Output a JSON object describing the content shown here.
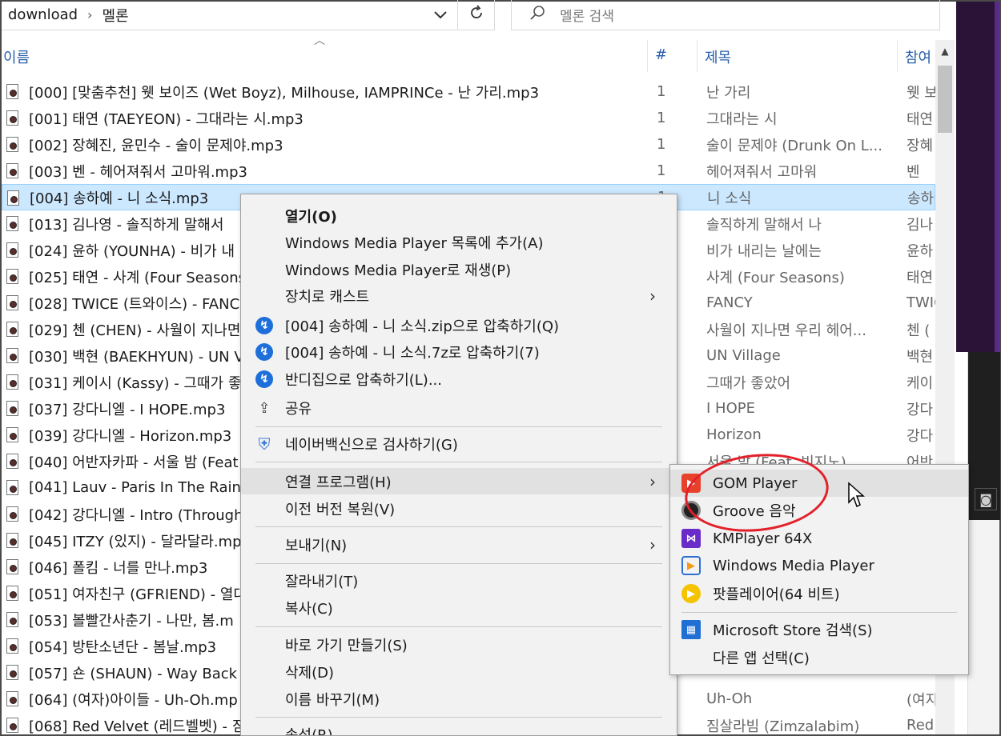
{
  "address": {
    "crumbs": [
      "download",
      "멜론"
    ]
  },
  "search": {
    "placeholder": "멜론 검색"
  },
  "columns": {
    "name": "이름",
    "num": "#",
    "title": "제목",
    "artist": "참여"
  },
  "rows": [
    {
      "name": "[000] [맞춤추천] 웻 보이즈 (Wet Boyz), Milhouse, IAMPRINCe - 난 가리.mp3",
      "num": "1",
      "title": "난 가리",
      "artist": "웻 보"
    },
    {
      "name": "[001] 태연 (TAEYEON) - 그대라는 시.mp3",
      "num": "1",
      "title": "그대라는 시",
      "artist": "태연"
    },
    {
      "name": "[002] 장혜진, 윤민수 - 술이 문제야.mp3",
      "num": "1",
      "title": "술이 문제야 (Drunk On L...",
      "artist": "장혜"
    },
    {
      "name": "[003] 벤 - 헤어져줘서 고마워.mp3",
      "num": "1",
      "title": "헤어져줘서 고마워",
      "artist": "벤"
    },
    {
      "name": "[004] 송하예 - 니 소식.mp3",
      "num": "1",
      "title": "니 소식",
      "artist": "송하"
    },
    {
      "name": "[013] 김나영 - 솔직하게 말해서",
      "num": "",
      "title": "솔직하게 말해서 나",
      "artist": "김나"
    },
    {
      "name": "[024] 윤하 (YOUNHA) - 비가 내",
      "num": "",
      "title": "비가 내리는 날에는",
      "artist": "윤하"
    },
    {
      "name": "[025] 태연 - 사계 (Four Seasons",
      "num": "",
      "title": "사계 (Four Seasons)",
      "artist": "태연"
    },
    {
      "name": "[028] TWICE (트와이스) - FANC",
      "num": "",
      "title": "FANCY",
      "artist": "TWIC"
    },
    {
      "name": "[029] 첸 (CHEN) - 사월이 지나면",
      "num": "",
      "title": "사월이 지나면 우리 헤어...",
      "artist": "첸 ("
    },
    {
      "name": "[030] 백현 (BAEKHYUN) - UN V",
      "num": "",
      "title": "UN Village",
      "artist": "백현"
    },
    {
      "name": "[031] 케이시 (Kassy) - 그때가 좋",
      "num": "",
      "title": "그때가 좋았어",
      "artist": "케이"
    },
    {
      "name": "[037] 강다니엘 - I HOPE.mp3",
      "num": "",
      "title": "I HOPE",
      "artist": "강다"
    },
    {
      "name": "[039] 강다니엘 - Horizon.mp3",
      "num": "",
      "title": "Horizon",
      "artist": "강다"
    },
    {
      "name": "[040] 어반자카파 - 서울 밤 (Feat",
      "num": "",
      "title": "서울 밤 (Feat. 빈지노)",
      "artist": "어반"
    },
    {
      "name": "[041] Lauv - Paris In The Rain.m",
      "num": "",
      "title": "",
      "artist": ""
    },
    {
      "name": "[042] 강다니엘 - Intro (Through",
      "num": "",
      "title": "",
      "artist": ""
    },
    {
      "name": "[045] ITZY (있지) - 달라달라.mp",
      "num": "",
      "title": "",
      "artist": ""
    },
    {
      "name": "[046] 폴킴 - 너를 만나.mp3",
      "num": "",
      "title": "",
      "artist": ""
    },
    {
      "name": "[051] 여자친구 (GFRIEND) - 열대",
      "num": "",
      "title": "",
      "artist": ""
    },
    {
      "name": "[053] 볼빨간사춘기 - 나만, 봄.m",
      "num": "",
      "title": "",
      "artist": ""
    },
    {
      "name": "[054] 방탄소년단 - 봄날.mp3",
      "num": "",
      "title": "",
      "artist": ""
    },
    {
      "name": "[057] 숀 (SHAUN) - Way Back H",
      "num": "",
      "title": "",
      "artist": ""
    },
    {
      "name": "[064] (여자)아이들 - Uh-Oh.mp",
      "num": "",
      "title": "Uh-Oh",
      "artist": "(여자"
    },
    {
      "name": "[068] Red Velvet (레드벨벳) - 짐",
      "num": "",
      "title": "짐살라빔 (Zimzalabim)",
      "artist": "Red"
    }
  ],
  "context_menu": {
    "open": "열기(O)",
    "wmp_add": "Windows Media Player 목록에 추가(A)",
    "wmp_play": "Windows Media Player로 재생(P)",
    "cast": "장치로 캐스트",
    "zip": "[004] 송하예 - 니 소식.zip으로 압축하기(Q)",
    "sevenz": "[004] 송하예 - 니 소식.7z로 압축하기(7)",
    "bandizip": "반디집으로 압축하기(L)...",
    "share": "공유",
    "naver": "네이버백신으로 검사하기(G)",
    "open_with": "연결 프로그램(H)",
    "restore": "이전 버전 복원(V)",
    "send_to": "보내기(N)",
    "cut": "잘라내기(T)",
    "copy": "복사(C)",
    "shortcut": "바로 가기 만들기(S)",
    "delete": "삭제(D)",
    "rename": "이름 바꾸기(M)",
    "properties": "속성(R)"
  },
  "submenu": {
    "gom": "GOM Player",
    "groove": "Groove 음악",
    "km": "KMPlayer 64X",
    "wmp": "Windows Media Player",
    "pot": "팟플레이어(64 비트)",
    "store": "Microsoft Store 검색(S)",
    "other": "다른 앱 선택(C)"
  },
  "colors": {
    "selection": "#cce8ff",
    "highlight_circle": "#e3202a",
    "header_text": "#2b5fa8"
  }
}
